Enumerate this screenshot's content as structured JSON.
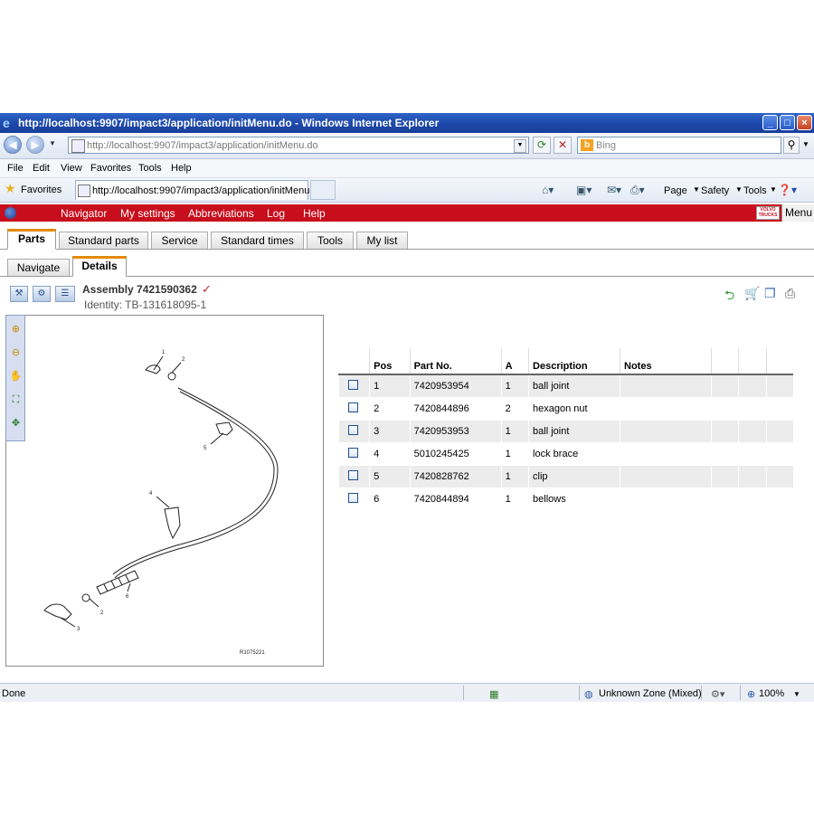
{
  "window": {
    "title": "http://localhost:9907/impact3/application/initMenu.do - Windows Internet Explorer"
  },
  "addressbar": {
    "url": "http://localhost:9907/impact3/application/initMenu.do",
    "search_placeholder": "Bing"
  },
  "menubar": [
    "File",
    "Edit",
    "View",
    "Favorites",
    "Tools",
    "Help"
  ],
  "favorites_bar": {
    "favorites_label": "Favorites",
    "tab_title": "http://localhost:9907/impact3/application/initMenu.do",
    "commands": [
      "Page",
      "Safety",
      "Tools"
    ]
  },
  "app_menu": {
    "items": [
      "Navigator",
      "My settings",
      "Abbreviations",
      "Log",
      "Help"
    ],
    "menu_label": "Menu",
    "brand_text": "VOLVO TRUCKS"
  },
  "tabs": [
    "Parts",
    "Standard parts",
    "Service",
    "Standard times",
    "Tools",
    "My list"
  ],
  "active_tab": "Parts",
  "subtabs": [
    "Navigate",
    "Details"
  ],
  "active_subtab": "Details",
  "assembly": {
    "title": "Assembly 7421590362",
    "identity": "Identity: TB-131618095-1"
  },
  "drawing": {
    "callouts": [
      "1",
      "2",
      "5",
      "4",
      "6",
      "2",
      "3"
    ],
    "reference": "R1075221"
  },
  "parts_table": {
    "columns": [
      "Pos",
      "Part No.",
      "A",
      "Description",
      "Notes"
    ],
    "rows": [
      {
        "pos": "1",
        "part_no": "7420953954",
        "a": "1",
        "description": "ball joint"
      },
      {
        "pos": "2",
        "part_no": "7420844896",
        "a": "2",
        "description": "hexagon nut"
      },
      {
        "pos": "3",
        "part_no": "7420953953",
        "a": "1",
        "description": "ball joint"
      },
      {
        "pos": "4",
        "part_no": "5010245425",
        "a": "1",
        "description": "lock brace"
      },
      {
        "pos": "5",
        "part_no": "7420828762",
        "a": "1",
        "description": "clip"
      },
      {
        "pos": "6",
        "part_no": "7420844894",
        "a": "1",
        "description": "bellows"
      }
    ]
  },
  "statusbar": {
    "left": "Done",
    "zone": "Unknown Zone (Mixed)",
    "zoom": "100%"
  }
}
